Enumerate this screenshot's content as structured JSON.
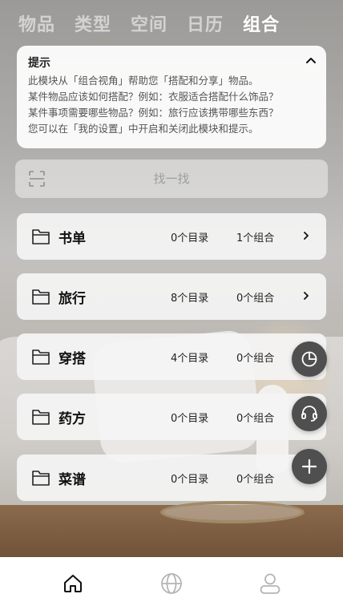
{
  "top_tabs": [
    {
      "label": "物品",
      "active": false
    },
    {
      "label": "类型",
      "active": false
    },
    {
      "label": "空间",
      "active": false
    },
    {
      "label": "日历",
      "active": false
    },
    {
      "label": "组合",
      "active": true
    }
  ],
  "tip": {
    "title": "提示",
    "lines": [
      "此模块从「组合视角」帮助您「搭配和分享」物品。",
      "某件物品应该如何搭配？例如：衣服适合搭配什么饰品？",
      "某件事项需要哪些物品？例如：旅行应该携带哪些东西？",
      "您可以在「我的设置」中开启和关闭此模块和提示。"
    ]
  },
  "search": {
    "placeholder": "找一找"
  },
  "groups": [
    {
      "name": "书单",
      "dirs": "0个目录",
      "combos": "1个组合",
      "has_chevron": true
    },
    {
      "name": "旅行",
      "dirs": "8个目录",
      "combos": "0个组合",
      "has_chevron": true
    },
    {
      "name": "穿搭",
      "dirs": "4个目录",
      "combos": "0个组合",
      "has_chevron": false
    },
    {
      "name": "药方",
      "dirs": "0个目录",
      "combos": "0个组合",
      "has_chevron": false
    },
    {
      "name": "菜谱",
      "dirs": "0个目录",
      "combos": "0个组合",
      "has_chevron": false
    }
  ],
  "fabs": [
    "pie-chart-icon",
    "headset-icon",
    "plus-icon"
  ],
  "bottom_nav": [
    "home-icon",
    "globe-icon",
    "user-icon"
  ],
  "colors": {
    "fab": "#4f4f4f",
    "active_tab": "#ffffff",
    "inactive_tab": "rgba(255,255,255,0.55)"
  }
}
